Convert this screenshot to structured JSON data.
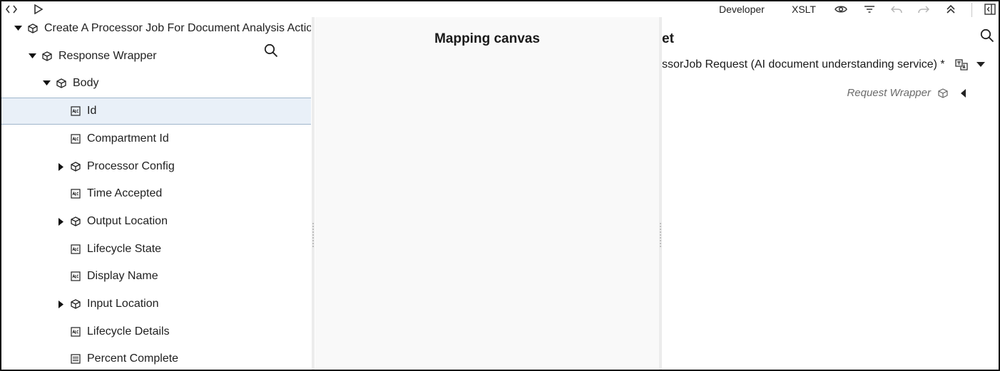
{
  "toolbar": {
    "code_icon": "code-icon",
    "run_icon": "play-icon",
    "developer_label": "Developer",
    "xslt_label": "XSLT",
    "icons": [
      "eye-icon",
      "filter-icon",
      "undo-icon",
      "redo-icon",
      "collapse-icon",
      "panel-toggle-icon"
    ]
  },
  "source": {
    "items": [
      {
        "label": "Create A Processor Job For Document Analysis Action",
        "type": "object",
        "expander": "expanded"
      },
      {
        "label": "Response Wrapper",
        "type": "object",
        "expander": "expanded"
      },
      {
        "label": "Body",
        "type": "object",
        "expander": "expanded"
      },
      {
        "label": "Id",
        "type": "string",
        "selected": true
      },
      {
        "label": "Compartment Id",
        "type": "string"
      },
      {
        "label": "Processor Config",
        "type": "object",
        "expander": "collapsed"
      },
      {
        "label": "Time Accepted",
        "type": "string"
      },
      {
        "label": "Output Location",
        "type": "object",
        "expander": "collapsed"
      },
      {
        "label": "Lifecycle State",
        "type": "string"
      },
      {
        "label": "Display Name",
        "type": "string"
      },
      {
        "label": "Input Location",
        "type": "object",
        "expander": "collapsed"
      },
      {
        "label": "Lifecycle Details",
        "type": "string"
      },
      {
        "label": "Percent Complete",
        "type": "number"
      }
    ]
  },
  "canvas": {
    "title": "Mapping canvas"
  },
  "target": {
    "title": "et",
    "root_label": "ssorJob Request (AI document understanding service) *",
    "child_label": "Request Wrapper"
  },
  "colors": {
    "selection_bg": "#e9f0f8",
    "selection_border": "#9fb6cc",
    "canvas_bg": "#f9f9f9"
  }
}
